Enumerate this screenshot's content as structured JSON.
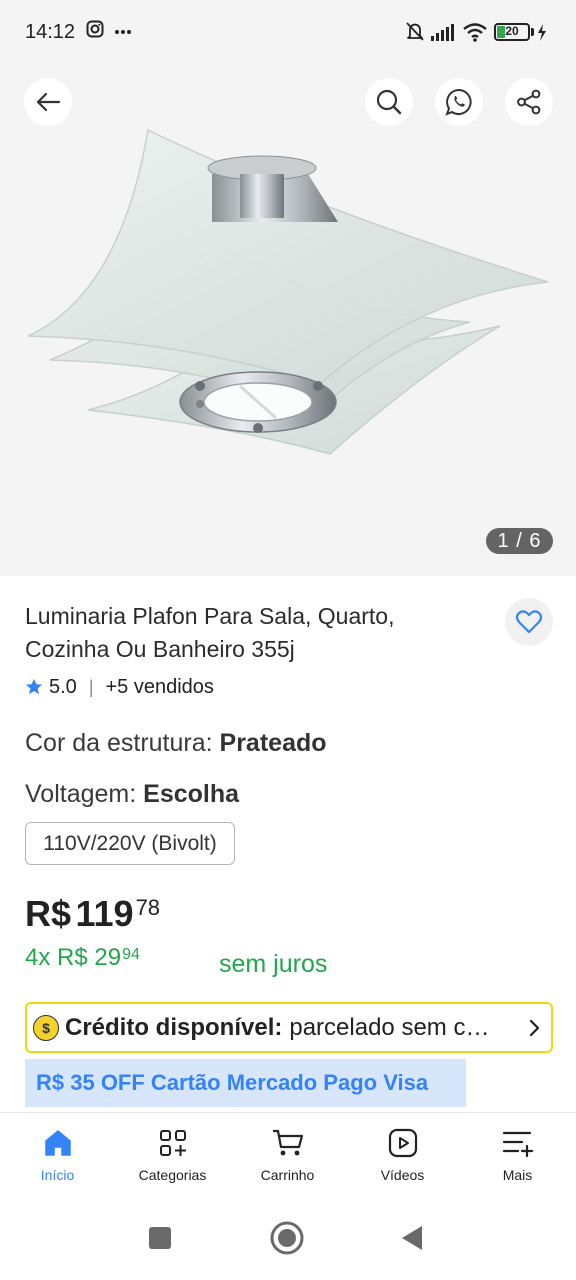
{
  "status_bar": {
    "time": "14:12",
    "battery_level": "20",
    "icons": [
      "instagram-icon",
      "more-icon",
      "mute-icon",
      "signal-icon",
      "wifi-icon",
      "battery-icon",
      "charging-icon"
    ]
  },
  "gallery": {
    "counter": "1 / 6",
    "image": "product-lamp-image"
  },
  "product": {
    "title": "Luminaria Plafon Para Sala, Quarto, Cozinha Ou Banheiro 355j",
    "rating": "5.0",
    "sold": "+5 vendidos",
    "color_label": "Cor da estrutura: ",
    "color_value": "Prateado",
    "voltage_label": "Voltagem: ",
    "voltage_value": "Escolha",
    "voltage_option": "110V/220V (Bivolt)"
  },
  "price": {
    "currency": "R$",
    "integer": "119",
    "cents": "78",
    "installments_prefix": "4x",
    "installment_currency": "R$",
    "installment_integer": "29",
    "installment_cents": "94",
    "no_interest": "sem juros"
  },
  "credit": {
    "title": "Crédito disponível:",
    "subtitle": "parcelado sem cartão"
  },
  "promo": {
    "text": "R$ 35 OFF Cartão Mercado Pago Visa"
  },
  "bottom_nav": [
    {
      "label": "Início",
      "icon": "home-icon",
      "active": true
    },
    {
      "label": "Categorias",
      "icon": "categories-icon",
      "active": false
    },
    {
      "label": "Carrinho",
      "icon": "cart-icon",
      "active": false
    },
    {
      "label": "Vídeos",
      "icon": "video-icon",
      "active": false
    },
    {
      "label": "Mais",
      "icon": "menu-add-icon",
      "active": false
    }
  ],
  "colors": {
    "accent_blue": "#3483fa",
    "green": "#1fa84a",
    "credit_border": "#f1d60a",
    "promo_bg": "#d8e6fb"
  }
}
